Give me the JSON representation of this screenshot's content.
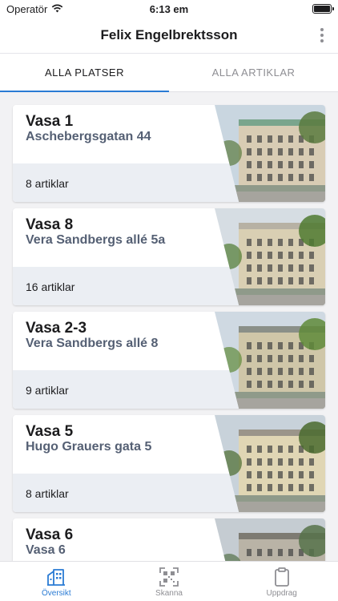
{
  "status_bar": {
    "carrier": "Operatör",
    "time": "6:13 em"
  },
  "header": {
    "title": "Felix Engelbrektsson",
    "more_icon": "more-vertical-icon"
  },
  "tabs": [
    {
      "label": "ALLA PLATSER",
      "active": true
    },
    {
      "label": "ALLA ARTIKLAR",
      "active": false
    }
  ],
  "locations": [
    {
      "name": "Vasa 1",
      "address": "Aschebergsgatan 44",
      "count": "8 artiklar",
      "sky": "#c9d6e0",
      "wall": "#d8ccb4",
      "roof": "#7aa58d",
      "trees": "#5b7a3e"
    },
    {
      "name": "Vasa 8",
      "address": "Vera Sandbergs allé 5a",
      "count": "16 artiklar",
      "sky": "#d6dde3",
      "wall": "#d9cfb3",
      "roof": "#b7b1a4",
      "trees": "#4f7a30"
    },
    {
      "name": "Vasa 2-3",
      "address": "Vera Sandbergs allé 8",
      "count": "9 artiklar",
      "sky": "#cfd9e2",
      "wall": "#cfc6a8",
      "roof": "#8a8f88",
      "trees": "#5f8a3a"
    },
    {
      "name": "Vasa 5",
      "address": "Hugo Grauers gata 5",
      "count": "8 artiklar",
      "sky": "#c8d2da",
      "wall": "#e0d6b4",
      "roof": "#9b958a",
      "trees": "#4a6b2e"
    },
    {
      "name": "Vasa 6",
      "address": "Vasa 6",
      "count": "",
      "sky": "#c5ccd2",
      "wall": "#b9b3a6",
      "roof": "#7d7a72",
      "trees": "#56724a"
    }
  ],
  "tab_bar": [
    {
      "label": "Översikt",
      "icon": "building-icon",
      "active": true
    },
    {
      "label": "Skanna",
      "icon": "qr-code-icon",
      "active": false
    },
    {
      "label": "Uppdrag",
      "icon": "clipboard-icon",
      "active": false
    }
  ],
  "colors": {
    "accent": "#2a7bd4",
    "address": "#556074",
    "card_footer": "#ebeef3"
  }
}
